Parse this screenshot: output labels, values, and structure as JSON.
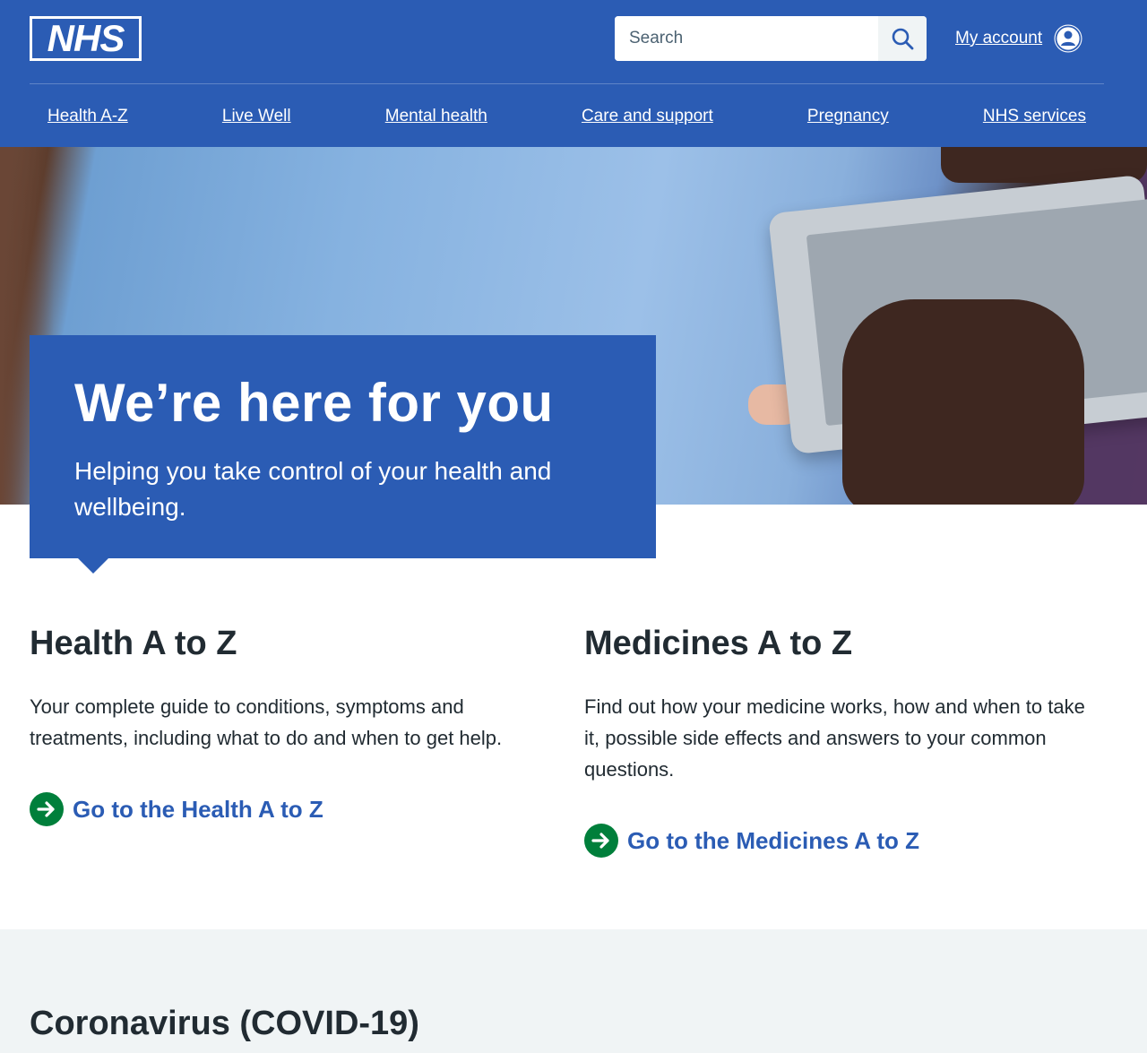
{
  "header": {
    "logo_text": "NHS",
    "search": {
      "placeholder": "Search"
    },
    "account_label": "My account",
    "nav": [
      {
        "label": "Health A-Z"
      },
      {
        "label": "Live Well"
      },
      {
        "label": "Mental health"
      },
      {
        "label": "Care and support"
      },
      {
        "label": "Pregnancy"
      },
      {
        "label": "NHS services"
      }
    ]
  },
  "hero": {
    "title": "We’re here for you",
    "subtitle": "Helping you take control of your health and wellbeing."
  },
  "sections": [
    {
      "title": "Health A to Z",
      "description": "Your complete guide to conditions, symptoms and treatments, including what to do and when to get help.",
      "action": "Go to the Health A to Z"
    },
    {
      "title": "Medicines A to Z",
      "description": "Find out how your medicine works, how and when to take it, possible side effects and answers to your common questions.",
      "action": "Go to the Medicines A to Z"
    }
  ],
  "covid": {
    "title": "Coronavirus (COVID-19)"
  },
  "colors": {
    "brand_blue": "#2b5cb4",
    "action_green": "#007f3b",
    "text_dark": "#212b32",
    "pale_grey": "#f0f4f5"
  },
  "icons": [
    "search-icon",
    "user-icon",
    "arrow-right-circle-icon"
  ]
}
